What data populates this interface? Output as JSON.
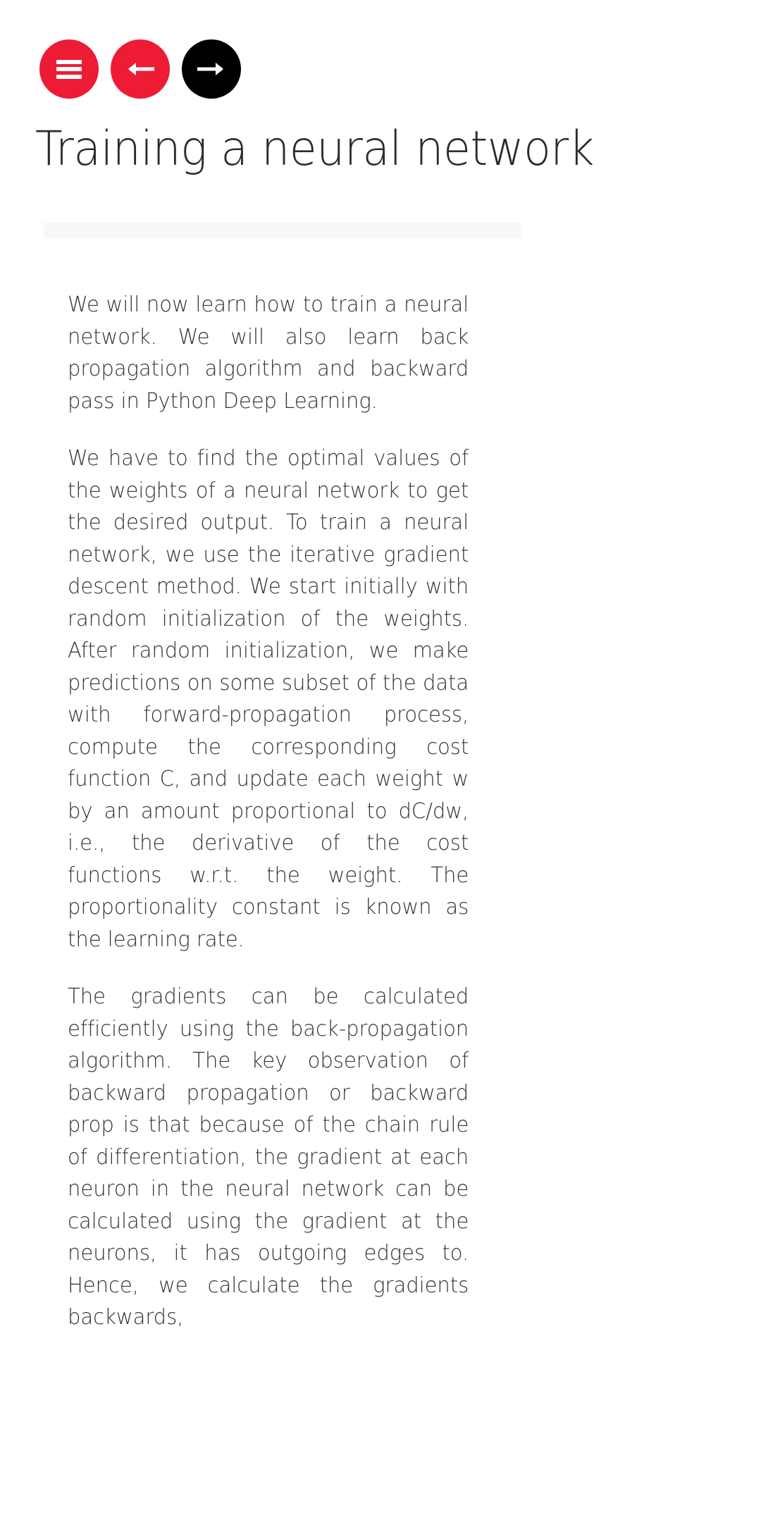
{
  "toolbar": {
    "menu_button": {
      "icon": "hamburger-menu-icon",
      "label": "Menu",
      "color": "#ED1B34"
    },
    "prev_button": {
      "icon": "arrow-left-icon",
      "label": "Previous",
      "color": "#ED1B34"
    },
    "next_button": {
      "icon": "arrow-right-icon",
      "label": "Next",
      "color": "#000000"
    }
  },
  "header": {
    "title": "Training a neural network"
  },
  "progress": {
    "track_color": "#F8F8F9",
    "value": ""
  },
  "article": {
    "paragraphs": [
      "We will now learn how to train a neural network. We will also learn back propagation algorithm and backward pass in Python Deep Learning.",
      "We have to find the optimal values of the weights of a neural network to get the desired output. To train a neural network, we use the iterative gradient descent method. We start initially with random initialization of the weights. After random initialization, we make predictions on some subset of the data with forward-propagation process, compute the corresponding cost function C, and update each weight w by an amount proportional to dC/dw, i.e., the derivative of the cost functions w.r.t. the weight. The proportionality constant is known as the learning rate.",
      "The gradients can be calculated efficiently using the back-propagation algorithm. The key observation of backward propagation or backward prop is that because of the chain rule of differentiation, the gradient at each neuron in the neural network can be calculated using the gradient at the neurons, it has outgoing edges to. Hence, we calculate the gradients backwards,"
    ]
  },
  "theme": {
    "background": "#FFFFFF",
    "text_color": "#343434",
    "title_color": "#2B2B2B",
    "accent_red": "#ED1B34",
    "accent_black": "#000000"
  }
}
